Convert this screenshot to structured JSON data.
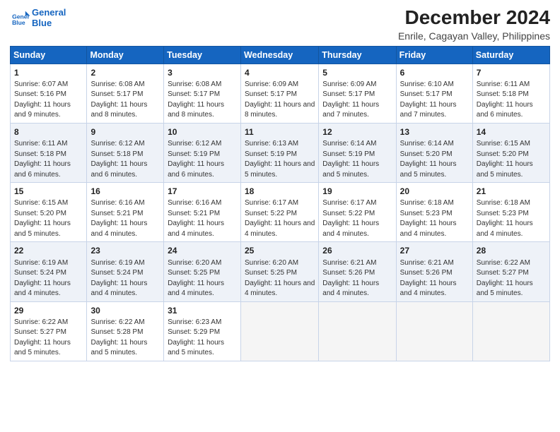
{
  "header": {
    "logo_line1": "General",
    "logo_line2": "Blue",
    "main_title": "December 2024",
    "subtitle": "Enrile, Cagayan Valley, Philippines"
  },
  "days_of_week": [
    "Sunday",
    "Monday",
    "Tuesday",
    "Wednesday",
    "Thursday",
    "Friday",
    "Saturday"
  ],
  "weeks": [
    [
      {
        "day": 1,
        "sunrise": "6:07 AM",
        "sunset": "5:16 PM",
        "daylight": "11 hours and 9 minutes."
      },
      {
        "day": 2,
        "sunrise": "6:08 AM",
        "sunset": "5:17 PM",
        "daylight": "11 hours and 8 minutes."
      },
      {
        "day": 3,
        "sunrise": "6:08 AM",
        "sunset": "5:17 PM",
        "daylight": "11 hours and 8 minutes."
      },
      {
        "day": 4,
        "sunrise": "6:09 AM",
        "sunset": "5:17 PM",
        "daylight": "11 hours and 8 minutes."
      },
      {
        "day": 5,
        "sunrise": "6:09 AM",
        "sunset": "5:17 PM",
        "daylight": "11 hours and 7 minutes."
      },
      {
        "day": 6,
        "sunrise": "6:10 AM",
        "sunset": "5:17 PM",
        "daylight": "11 hours and 7 minutes."
      },
      {
        "day": 7,
        "sunrise": "6:11 AM",
        "sunset": "5:18 PM",
        "daylight": "11 hours and 6 minutes."
      }
    ],
    [
      {
        "day": 8,
        "sunrise": "6:11 AM",
        "sunset": "5:18 PM",
        "daylight": "11 hours and 6 minutes."
      },
      {
        "day": 9,
        "sunrise": "6:12 AM",
        "sunset": "5:18 PM",
        "daylight": "11 hours and 6 minutes."
      },
      {
        "day": 10,
        "sunrise": "6:12 AM",
        "sunset": "5:19 PM",
        "daylight": "11 hours and 6 minutes."
      },
      {
        "day": 11,
        "sunrise": "6:13 AM",
        "sunset": "5:19 PM",
        "daylight": "11 hours and 5 minutes."
      },
      {
        "day": 12,
        "sunrise": "6:14 AM",
        "sunset": "5:19 PM",
        "daylight": "11 hours and 5 minutes."
      },
      {
        "day": 13,
        "sunrise": "6:14 AM",
        "sunset": "5:20 PM",
        "daylight": "11 hours and 5 minutes."
      },
      {
        "day": 14,
        "sunrise": "6:15 AM",
        "sunset": "5:20 PM",
        "daylight": "11 hours and 5 minutes."
      }
    ],
    [
      {
        "day": 15,
        "sunrise": "6:15 AM",
        "sunset": "5:20 PM",
        "daylight": "11 hours and 5 minutes."
      },
      {
        "day": 16,
        "sunrise": "6:16 AM",
        "sunset": "5:21 PM",
        "daylight": "11 hours and 4 minutes."
      },
      {
        "day": 17,
        "sunrise": "6:16 AM",
        "sunset": "5:21 PM",
        "daylight": "11 hours and 4 minutes."
      },
      {
        "day": 18,
        "sunrise": "6:17 AM",
        "sunset": "5:22 PM",
        "daylight": "11 hours and 4 minutes."
      },
      {
        "day": 19,
        "sunrise": "6:17 AM",
        "sunset": "5:22 PM",
        "daylight": "11 hours and 4 minutes."
      },
      {
        "day": 20,
        "sunrise": "6:18 AM",
        "sunset": "5:23 PM",
        "daylight": "11 hours and 4 minutes."
      },
      {
        "day": 21,
        "sunrise": "6:18 AM",
        "sunset": "5:23 PM",
        "daylight": "11 hours and 4 minutes."
      }
    ],
    [
      {
        "day": 22,
        "sunrise": "6:19 AM",
        "sunset": "5:24 PM",
        "daylight": "11 hours and 4 minutes."
      },
      {
        "day": 23,
        "sunrise": "6:19 AM",
        "sunset": "5:24 PM",
        "daylight": "11 hours and 4 minutes."
      },
      {
        "day": 24,
        "sunrise": "6:20 AM",
        "sunset": "5:25 PM",
        "daylight": "11 hours and 4 minutes."
      },
      {
        "day": 25,
        "sunrise": "6:20 AM",
        "sunset": "5:25 PM",
        "daylight": "11 hours and 4 minutes."
      },
      {
        "day": 26,
        "sunrise": "6:21 AM",
        "sunset": "5:26 PM",
        "daylight": "11 hours and 4 minutes."
      },
      {
        "day": 27,
        "sunrise": "6:21 AM",
        "sunset": "5:26 PM",
        "daylight": "11 hours and 4 minutes."
      },
      {
        "day": 28,
        "sunrise": "6:22 AM",
        "sunset": "5:27 PM",
        "daylight": "11 hours and 5 minutes."
      }
    ],
    [
      {
        "day": 29,
        "sunrise": "6:22 AM",
        "sunset": "5:27 PM",
        "daylight": "11 hours and 5 minutes."
      },
      {
        "day": 30,
        "sunrise": "6:22 AM",
        "sunset": "5:28 PM",
        "daylight": "11 hours and 5 minutes."
      },
      {
        "day": 31,
        "sunrise": "6:23 AM",
        "sunset": "5:29 PM",
        "daylight": "11 hours and 5 minutes."
      },
      null,
      null,
      null,
      null
    ]
  ]
}
